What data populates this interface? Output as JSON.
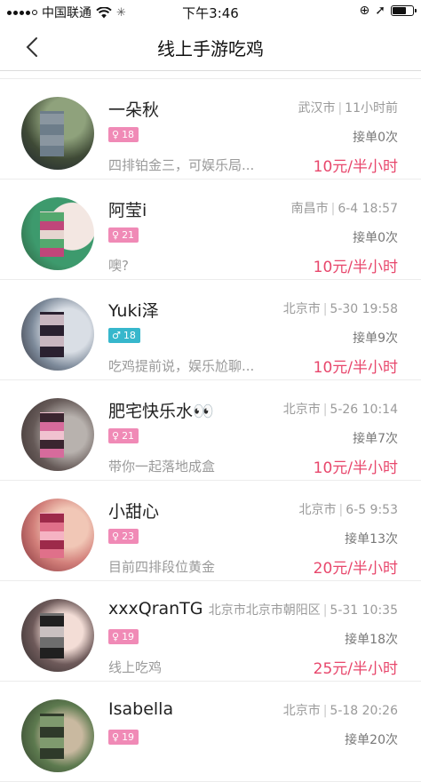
{
  "status_bar": {
    "carrier": "中国联通",
    "time": "下午3:46",
    "battery_level": 0.72,
    "icons": [
      "signal-icon",
      "wifi-icon",
      "loading-icon",
      "lock-rotation-icon",
      "location-icon",
      "battery-icon"
    ]
  },
  "nav": {
    "title": "线上手游吃鸡",
    "back_icon": "chevron-left-icon"
  },
  "colors": {
    "accent_price": "#e8476c",
    "badge_female": "#f08ab6",
    "badge_male": "#37b7cc"
  },
  "players": [
    {
      "name": "一朵秋",
      "gender": "♀",
      "gender_type": "female",
      "age": "18",
      "city": "武汉市",
      "time": "11小时前",
      "orders": "接单0次",
      "intro": "四排铂金三，可娱乐局...",
      "price": "10元",
      "unit": "/半小时"
    },
    {
      "name": "阿莹i",
      "gender": "♀",
      "gender_type": "female",
      "age": "21",
      "city": "南昌市",
      "time": "6-4 18:57",
      "orders": "接单0次",
      "intro": "噢?",
      "price": "10元",
      "unit": "/半小时"
    },
    {
      "name": "Yuki泽",
      "gender": "♂",
      "gender_type": "male",
      "age": "18",
      "city": "北京市",
      "time": "5-30 19:58",
      "orders": "接单9次",
      "intro": "吃鸡提前说，娱乐尬聊...",
      "price": "10元",
      "unit": "/半小时"
    },
    {
      "name": "肥宅快乐水👀",
      "gender": "♀",
      "gender_type": "female",
      "age": "21",
      "city": "北京市",
      "time": "5-26 10:14",
      "orders": "接单7次",
      "intro": "带你一起落地成盒",
      "price": "10元",
      "unit": "/半小时"
    },
    {
      "name": "小甜心",
      "gender": "♀",
      "gender_type": "female",
      "age": "23",
      "city": "北京市",
      "time": "6-5 9:53",
      "orders": "接单13次",
      "intro": "目前四排段位黄金",
      "price": "20元",
      "unit": "/半小时"
    },
    {
      "name": "xxxQranTG",
      "gender": "♀",
      "gender_type": "female",
      "age": "19",
      "city": "北京市北京市朝阳区",
      "time": "5-31 10:35",
      "orders": "接单18次",
      "intro": "线上吃鸡",
      "price": "25元",
      "unit": "/半小时"
    },
    {
      "name": "Isabella",
      "gender": "♀",
      "gender_type": "female",
      "age": "19",
      "city": "北京市",
      "time": "5-18 20:26",
      "orders": "接单20次",
      "intro": "",
      "price": "",
      "unit": ""
    }
  ]
}
